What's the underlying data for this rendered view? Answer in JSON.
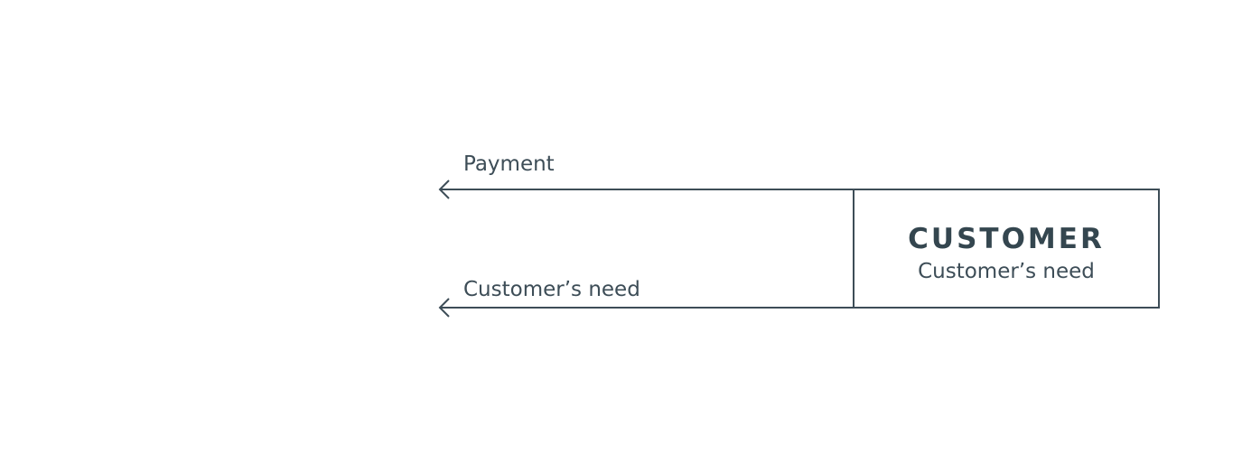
{
  "diagram": {
    "arrows": [
      {
        "label": "Payment"
      },
      {
        "label": "Customer’s need"
      }
    ],
    "customer_box": {
      "title": "CUSTOMER",
      "subtitle": "Customer’s need"
    },
    "colors": {
      "stroke": "#3d4d57",
      "text": "#3d4d57",
      "background": "#ffffff"
    }
  }
}
